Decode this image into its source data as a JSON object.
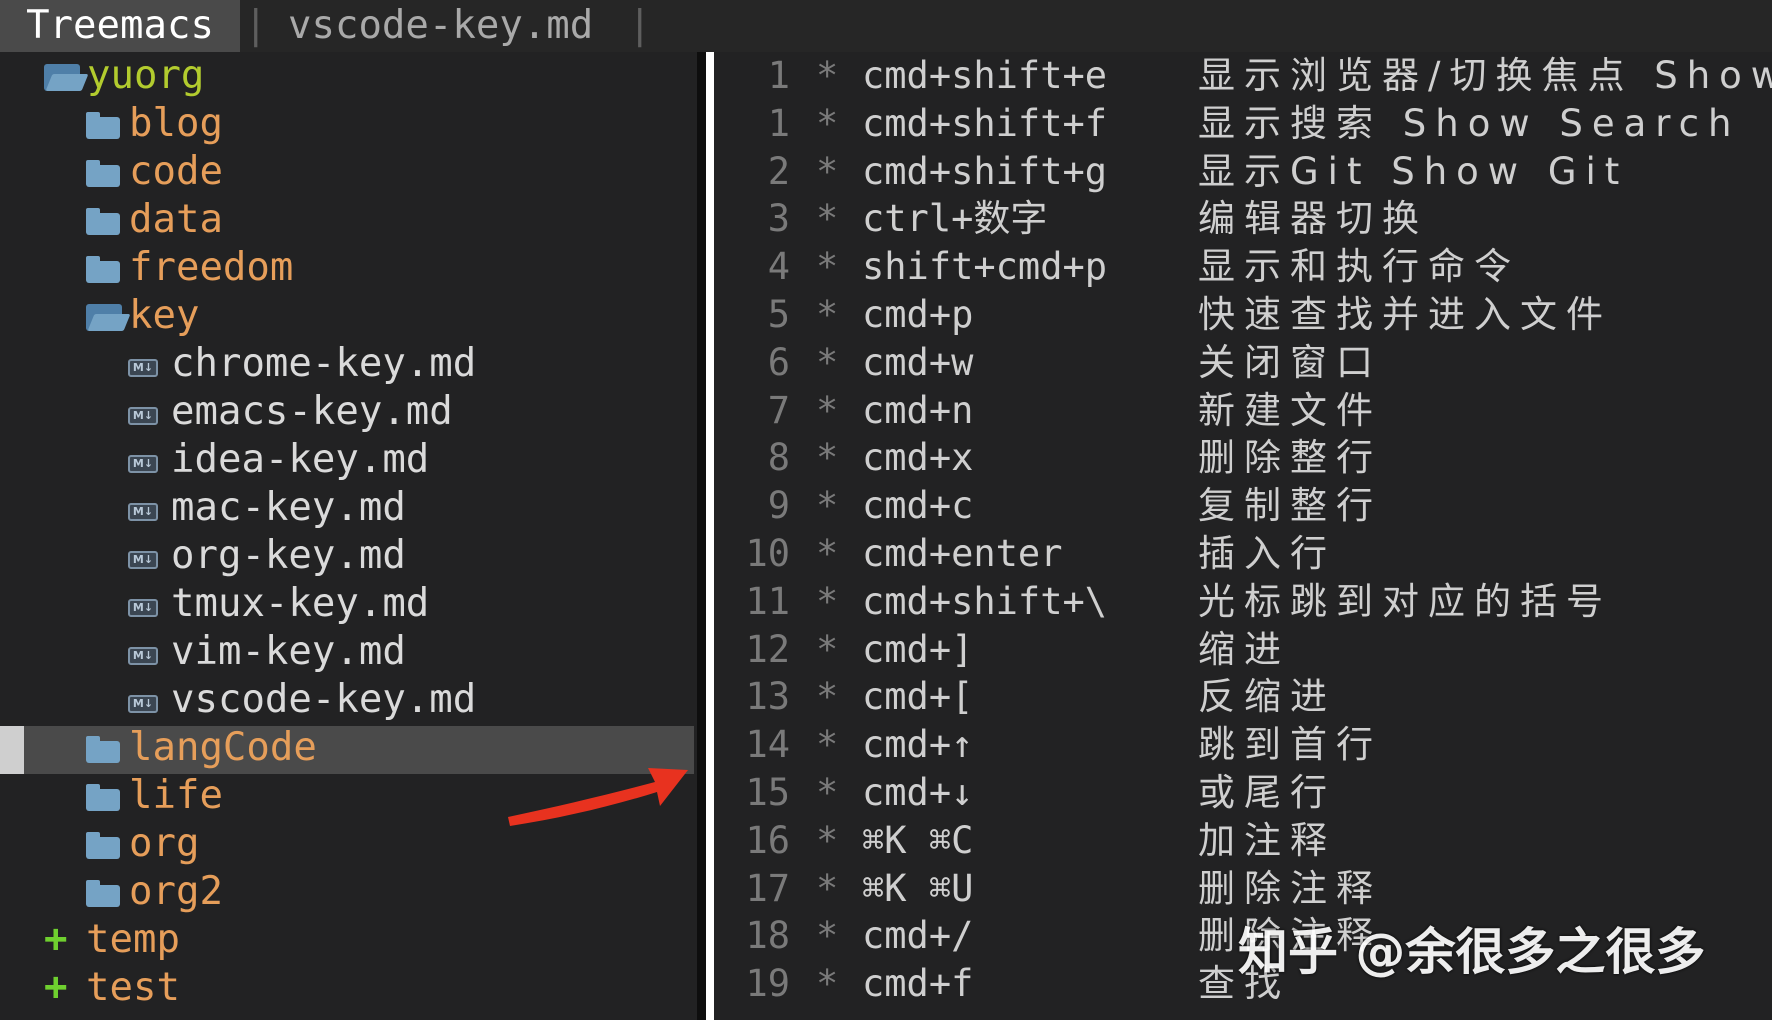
{
  "tabs": {
    "treemacs": "Treemacs",
    "separator": "|",
    "file": "vscode-key.md"
  },
  "tree": [
    {
      "type": "root",
      "label": "yuorg",
      "icon": "folder-open-icon",
      "expanded": true
    },
    {
      "type": "folder",
      "label": "blog",
      "icon": "folder-icon"
    },
    {
      "type": "folder",
      "label": "code",
      "icon": "folder-icon"
    },
    {
      "type": "folder",
      "label": "data",
      "icon": "folder-icon"
    },
    {
      "type": "folder",
      "label": "freedom",
      "icon": "folder-icon"
    },
    {
      "type": "open",
      "label": "key",
      "icon": "folder-open-icon",
      "expanded": true
    },
    {
      "type": "file",
      "label": "chrome-key.md",
      "icon": "markdown-icon"
    },
    {
      "type": "file",
      "label": "emacs-key.md",
      "icon": "markdown-icon"
    },
    {
      "type": "file",
      "label": "idea-key.md",
      "icon": "markdown-icon"
    },
    {
      "type": "file",
      "label": "mac-key.md",
      "icon": "markdown-icon"
    },
    {
      "type": "file",
      "label": "org-key.md",
      "icon": "markdown-icon"
    },
    {
      "type": "file",
      "label": "tmux-key.md",
      "icon": "markdown-icon"
    },
    {
      "type": "file",
      "label": "vim-key.md",
      "icon": "markdown-icon"
    },
    {
      "type": "file",
      "label": "vscode-key.md",
      "icon": "markdown-icon",
      "selected": true
    },
    {
      "type": "folder",
      "label": "langCode",
      "icon": "folder-icon"
    },
    {
      "type": "folder",
      "label": "life",
      "icon": "folder-icon"
    },
    {
      "type": "folder",
      "label": "org",
      "icon": "folder-icon"
    },
    {
      "type": "folder",
      "label": "org2",
      "icon": "folder-icon"
    },
    {
      "type": "plus",
      "label": "temp",
      "icon": "plus-icon",
      "sign": "+"
    },
    {
      "type": "plus",
      "label": "test",
      "icon": "plus-icon",
      "sign": "+"
    }
  ],
  "editor_lines": [
    {
      "num": "1",
      "star": "*",
      "key": "cmd+shift+e",
      "desc": "显示浏览器/切换焦点 Show"
    },
    {
      "num": "1",
      "star": "*",
      "key": "cmd+shift+f",
      "desc": "显示搜索 Show Search"
    },
    {
      "num": "2",
      "star": "*",
      "key": "cmd+shift+g",
      "desc": "显示Git Show Git"
    },
    {
      "num": "3",
      "star": "*",
      "key": "ctrl+数字",
      "desc": " 编辑器切换"
    },
    {
      "num": "4",
      "star": "*",
      "key": "shift+cmd+p",
      "desc": "显示和执行命令"
    },
    {
      "num": "5",
      "star": "*",
      "key": "cmd+p",
      "desc": "快速查找并进入文件"
    },
    {
      "num": "6",
      "star": "*",
      "key": "cmd+w",
      "desc": "关闭窗口"
    },
    {
      "num": "7",
      "star": "*",
      "key": "cmd+n",
      "desc": "新建文件"
    },
    {
      "num": "8",
      "star": "*",
      "key": "cmd+x",
      "desc": "删除整行"
    },
    {
      "num": "9",
      "star": "*",
      "key": "cmd+c",
      "desc": "复制整行"
    },
    {
      "num": "10",
      "star": "*",
      "key": "cmd+enter",
      "desc": "插入行"
    },
    {
      "num": "11",
      "star": "*",
      "key": "cmd+shift+\\",
      "desc": "光标跳到对应的括号"
    },
    {
      "num": "12",
      "star": "*",
      "key": "cmd+]",
      "desc": "缩进"
    },
    {
      "num": "13",
      "star": "*",
      "key": "cmd+[",
      "desc": "反缩进"
    },
    {
      "num": "14",
      "star": "*",
      "key": "cmd+↑",
      "desc": "跳到首行"
    },
    {
      "num": "15",
      "star": "*",
      "key": "cmd+↓",
      "desc": "或尾行"
    },
    {
      "num": "16",
      "star": "*",
      "key": "⌘K ⌘C",
      "desc": "加注释"
    },
    {
      "num": "17",
      "star": "*",
      "key": "⌘K ⌘U",
      "desc": "删除注释"
    },
    {
      "num": "18",
      "star": "*",
      "key": "cmd+/",
      "desc": "删除注释"
    },
    {
      "num": "19",
      "star": "*",
      "key": "cmd+f",
      "desc": "查找"
    }
  ],
  "watermark": "知乎 @余很多之很多",
  "colors": {
    "folder": "#75a3c5",
    "folder_label": "#e69e5a",
    "root_label": "#b3cc2e",
    "plus": "#6fd02f",
    "arrow": "#e8321f",
    "selection": "#4a4a4a"
  }
}
